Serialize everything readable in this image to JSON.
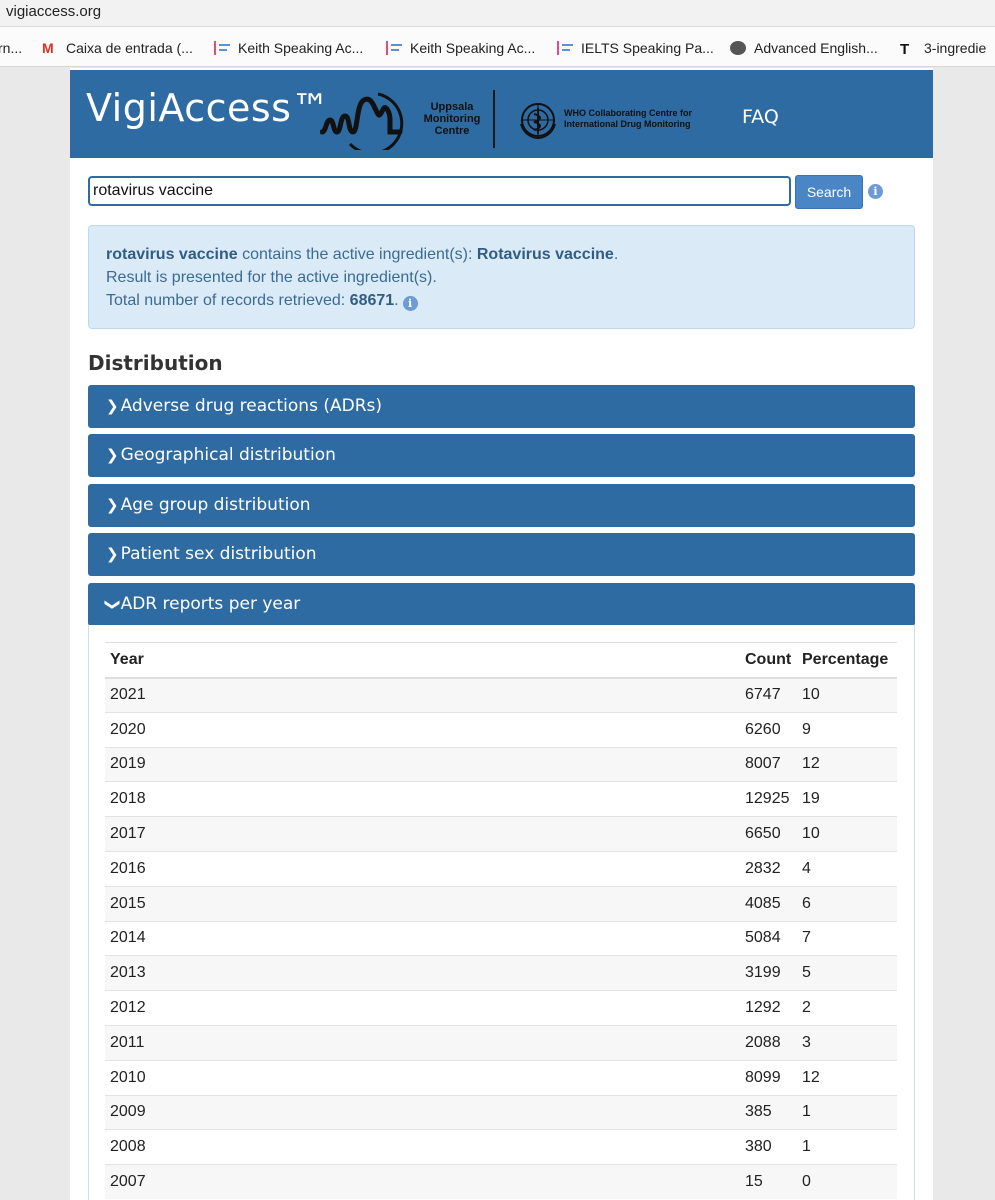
{
  "browser": {
    "url": "vigiaccess.org",
    "bookmarks": [
      {
        "label": "rn...",
        "icon": "none"
      },
      {
        "label": "Caixa de entrada (...",
        "icon": "gmail-icon"
      },
      {
        "label": "Keith Speaking Ac...",
        "icon": "keith-icon"
      },
      {
        "label": "Keith Speaking Ac...",
        "icon": "keith-icon"
      },
      {
        "label": "IELTS Speaking Pa...",
        "icon": "keith-icon"
      },
      {
        "label": "Advanced English...",
        "icon": "globe-icon"
      },
      {
        "label": "3-ingredie",
        "icon": "t-icon"
      }
    ]
  },
  "header": {
    "brand": "VigiAccess™",
    "umc_label": "Uppsala Monitoring Centre",
    "who_label": "WHO Collaborating Centre for International Drug Monitoring",
    "faq": "FAQ",
    "color": "#2f6ba3"
  },
  "search": {
    "value": "rotavirus vaccine",
    "button": "Search",
    "info_glyph": "i"
  },
  "result": {
    "query": "rotavirus vaccine",
    "line1_mid": " contains the active ingredient(s): ",
    "ingredient": "Rotavirus vaccine",
    "line1_end": ".",
    "line2": "Result is presented for the active ingredient(s).",
    "line3": "Total number of records retrieved: ",
    "total": "68671",
    "line3_end": "."
  },
  "distribution": {
    "title": "Distribution",
    "sections": [
      {
        "label": "Adverse drug reactions (ADRs)",
        "expanded": false
      },
      {
        "label": "Geographical distribution",
        "expanded": false
      },
      {
        "label": "Age group distribution",
        "expanded": false
      },
      {
        "label": "Patient sex distribution",
        "expanded": false
      },
      {
        "label": "ADR reports per year",
        "expanded": true
      }
    ],
    "chevron_collapsed": "❯",
    "chevron_expanded": "❯"
  },
  "table": {
    "headers": [
      "Year",
      "Count",
      "Percentage"
    ],
    "rows": [
      [
        "2021",
        "6747",
        "10"
      ],
      [
        "2020",
        "6260",
        "9"
      ],
      [
        "2019",
        "8007",
        "12"
      ],
      [
        "2018",
        "12925",
        "19"
      ],
      [
        "2017",
        "6650",
        "10"
      ],
      [
        "2016",
        "2832",
        "4"
      ],
      [
        "2015",
        "4085",
        "6"
      ],
      [
        "2014",
        "5084",
        "7"
      ],
      [
        "2013",
        "3199",
        "5"
      ],
      [
        "2012",
        "1292",
        "2"
      ],
      [
        "2011",
        "2088",
        "3"
      ],
      [
        "2010",
        "8099",
        "12"
      ],
      [
        "2009",
        "385",
        "1"
      ],
      [
        "2008",
        "380",
        "1"
      ],
      [
        "2007",
        "15",
        "0"
      ]
    ]
  }
}
